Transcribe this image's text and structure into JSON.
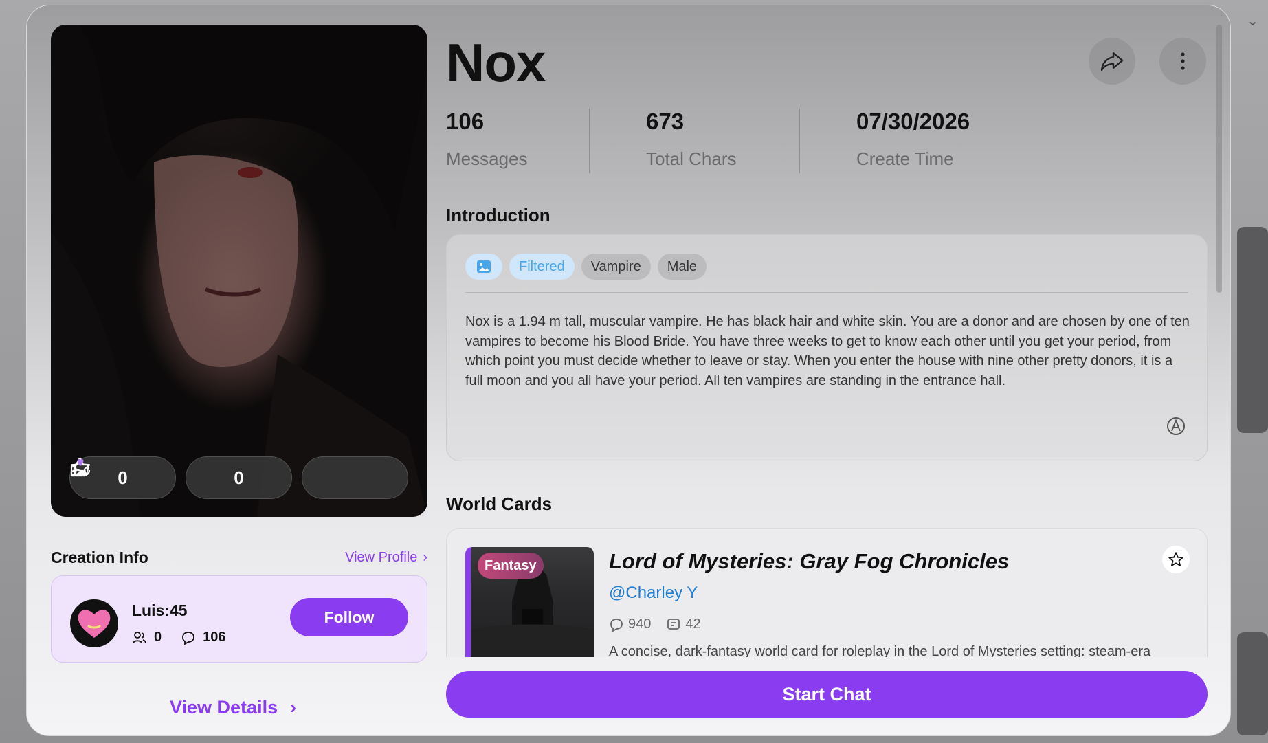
{
  "character": {
    "name": "Nox",
    "likes": "0",
    "favorites": "0"
  },
  "stats": [
    {
      "value": "106",
      "label": "Messages"
    },
    {
      "value": "673",
      "label": "Total Chars"
    },
    {
      "value": "07/30/2026",
      "label": "Create Time"
    }
  ],
  "sections": {
    "introduction": "Introduction",
    "world_cards": "World Cards",
    "creation_info": "Creation Info"
  },
  "tags": [
    "Filtered",
    "Vampire",
    "Male"
  ],
  "introduction_text": "Nox is a 1.94 m tall, muscular vampire. He has black hair and white skin. You are a donor and are chosen by one of ten vampires to become his Blood Bride. You have three weeks to get to know each other until you get your period, from which point you must decide whether to leave or stay. When you enter the house with nine other pretty donors, it is a full moon and you all have your period. All ten vampires are standing in the entrance hall.",
  "creator": {
    "view_profile": "View Profile",
    "name": "Luis:45",
    "followers": "0",
    "chats": "106",
    "follow_label": "Follow"
  },
  "view_details": "View Details",
  "world_card": {
    "genre": "Fantasy",
    "title": "Lord of Mysteries: Gray Fog Chronicles",
    "author": "@Charley Y",
    "chats": "940",
    "messages": "42",
    "description": "A concise, dark-fantasy world card for roleplay in the Lord of Mysteries setting: steam-era"
  },
  "start_chat": "Start Chat",
  "colors": {
    "accent": "#8a3cf0",
    "link": "#1f7fd6",
    "filtered_tag": "#4aa6e8"
  }
}
